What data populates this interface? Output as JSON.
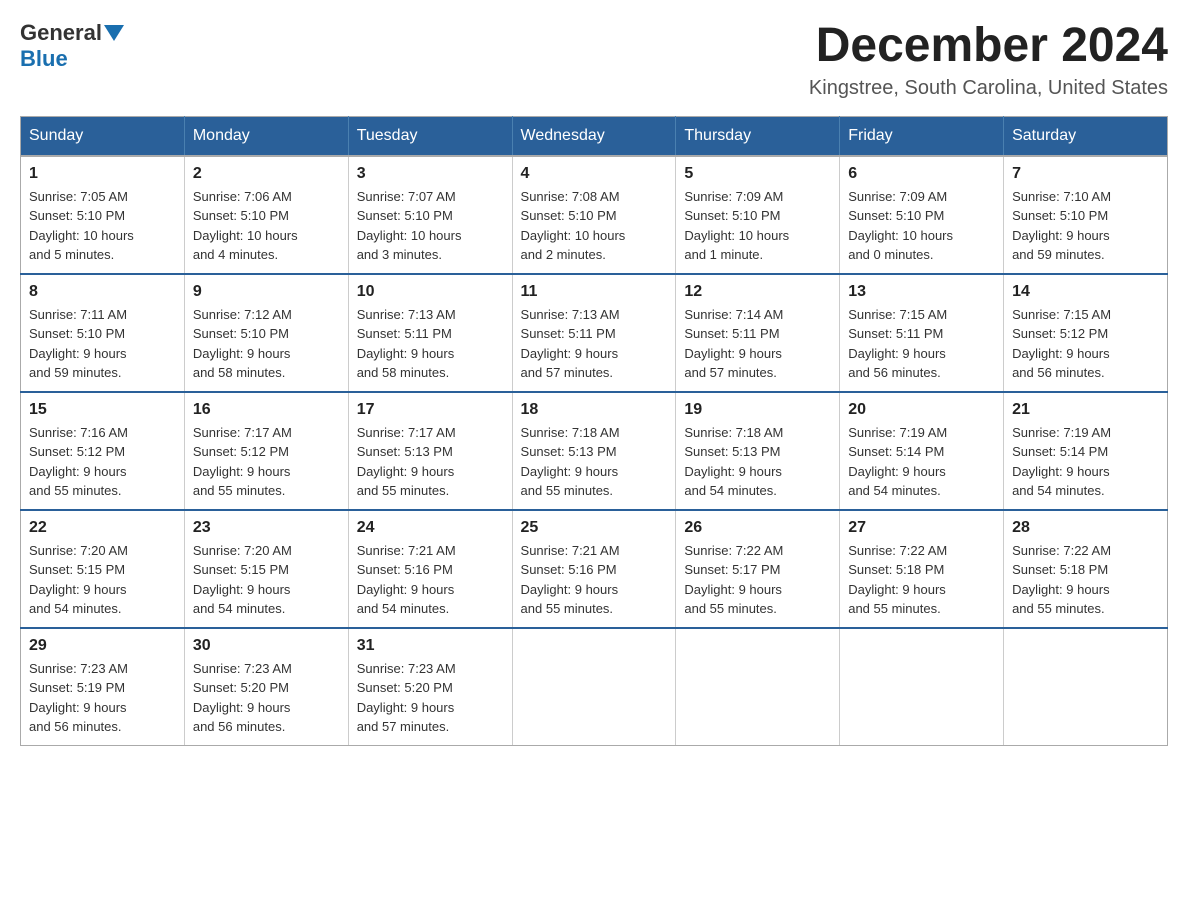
{
  "header": {
    "logo_general": "General",
    "logo_blue": "Blue",
    "month_title": "December 2024",
    "subtitle": "Kingstree, South Carolina, United States"
  },
  "days_of_week": [
    "Sunday",
    "Monday",
    "Tuesday",
    "Wednesday",
    "Thursday",
    "Friday",
    "Saturday"
  ],
  "weeks": [
    [
      {
        "day": "1",
        "info": "Sunrise: 7:05 AM\nSunset: 5:10 PM\nDaylight: 10 hours\nand 5 minutes."
      },
      {
        "day": "2",
        "info": "Sunrise: 7:06 AM\nSunset: 5:10 PM\nDaylight: 10 hours\nand 4 minutes."
      },
      {
        "day": "3",
        "info": "Sunrise: 7:07 AM\nSunset: 5:10 PM\nDaylight: 10 hours\nand 3 minutes."
      },
      {
        "day": "4",
        "info": "Sunrise: 7:08 AM\nSunset: 5:10 PM\nDaylight: 10 hours\nand 2 minutes."
      },
      {
        "day": "5",
        "info": "Sunrise: 7:09 AM\nSunset: 5:10 PM\nDaylight: 10 hours\nand 1 minute."
      },
      {
        "day": "6",
        "info": "Sunrise: 7:09 AM\nSunset: 5:10 PM\nDaylight: 10 hours\nand 0 minutes."
      },
      {
        "day": "7",
        "info": "Sunrise: 7:10 AM\nSunset: 5:10 PM\nDaylight: 9 hours\nand 59 minutes."
      }
    ],
    [
      {
        "day": "8",
        "info": "Sunrise: 7:11 AM\nSunset: 5:10 PM\nDaylight: 9 hours\nand 59 minutes."
      },
      {
        "day": "9",
        "info": "Sunrise: 7:12 AM\nSunset: 5:10 PM\nDaylight: 9 hours\nand 58 minutes."
      },
      {
        "day": "10",
        "info": "Sunrise: 7:13 AM\nSunset: 5:11 PM\nDaylight: 9 hours\nand 58 minutes."
      },
      {
        "day": "11",
        "info": "Sunrise: 7:13 AM\nSunset: 5:11 PM\nDaylight: 9 hours\nand 57 minutes."
      },
      {
        "day": "12",
        "info": "Sunrise: 7:14 AM\nSunset: 5:11 PM\nDaylight: 9 hours\nand 57 minutes."
      },
      {
        "day": "13",
        "info": "Sunrise: 7:15 AM\nSunset: 5:11 PM\nDaylight: 9 hours\nand 56 minutes."
      },
      {
        "day": "14",
        "info": "Sunrise: 7:15 AM\nSunset: 5:12 PM\nDaylight: 9 hours\nand 56 minutes."
      }
    ],
    [
      {
        "day": "15",
        "info": "Sunrise: 7:16 AM\nSunset: 5:12 PM\nDaylight: 9 hours\nand 55 minutes."
      },
      {
        "day": "16",
        "info": "Sunrise: 7:17 AM\nSunset: 5:12 PM\nDaylight: 9 hours\nand 55 minutes."
      },
      {
        "day": "17",
        "info": "Sunrise: 7:17 AM\nSunset: 5:13 PM\nDaylight: 9 hours\nand 55 minutes."
      },
      {
        "day": "18",
        "info": "Sunrise: 7:18 AM\nSunset: 5:13 PM\nDaylight: 9 hours\nand 55 minutes."
      },
      {
        "day": "19",
        "info": "Sunrise: 7:18 AM\nSunset: 5:13 PM\nDaylight: 9 hours\nand 54 minutes."
      },
      {
        "day": "20",
        "info": "Sunrise: 7:19 AM\nSunset: 5:14 PM\nDaylight: 9 hours\nand 54 minutes."
      },
      {
        "day": "21",
        "info": "Sunrise: 7:19 AM\nSunset: 5:14 PM\nDaylight: 9 hours\nand 54 minutes."
      }
    ],
    [
      {
        "day": "22",
        "info": "Sunrise: 7:20 AM\nSunset: 5:15 PM\nDaylight: 9 hours\nand 54 minutes."
      },
      {
        "day": "23",
        "info": "Sunrise: 7:20 AM\nSunset: 5:15 PM\nDaylight: 9 hours\nand 54 minutes."
      },
      {
        "day": "24",
        "info": "Sunrise: 7:21 AM\nSunset: 5:16 PM\nDaylight: 9 hours\nand 54 minutes."
      },
      {
        "day": "25",
        "info": "Sunrise: 7:21 AM\nSunset: 5:16 PM\nDaylight: 9 hours\nand 55 minutes."
      },
      {
        "day": "26",
        "info": "Sunrise: 7:22 AM\nSunset: 5:17 PM\nDaylight: 9 hours\nand 55 minutes."
      },
      {
        "day": "27",
        "info": "Sunrise: 7:22 AM\nSunset: 5:18 PM\nDaylight: 9 hours\nand 55 minutes."
      },
      {
        "day": "28",
        "info": "Sunrise: 7:22 AM\nSunset: 5:18 PM\nDaylight: 9 hours\nand 55 minutes."
      }
    ],
    [
      {
        "day": "29",
        "info": "Sunrise: 7:23 AM\nSunset: 5:19 PM\nDaylight: 9 hours\nand 56 minutes."
      },
      {
        "day": "30",
        "info": "Sunrise: 7:23 AM\nSunset: 5:20 PM\nDaylight: 9 hours\nand 56 minutes."
      },
      {
        "day": "31",
        "info": "Sunrise: 7:23 AM\nSunset: 5:20 PM\nDaylight: 9 hours\nand 57 minutes."
      },
      {
        "day": "",
        "info": ""
      },
      {
        "day": "",
        "info": ""
      },
      {
        "day": "",
        "info": ""
      },
      {
        "day": "",
        "info": ""
      }
    ]
  ]
}
